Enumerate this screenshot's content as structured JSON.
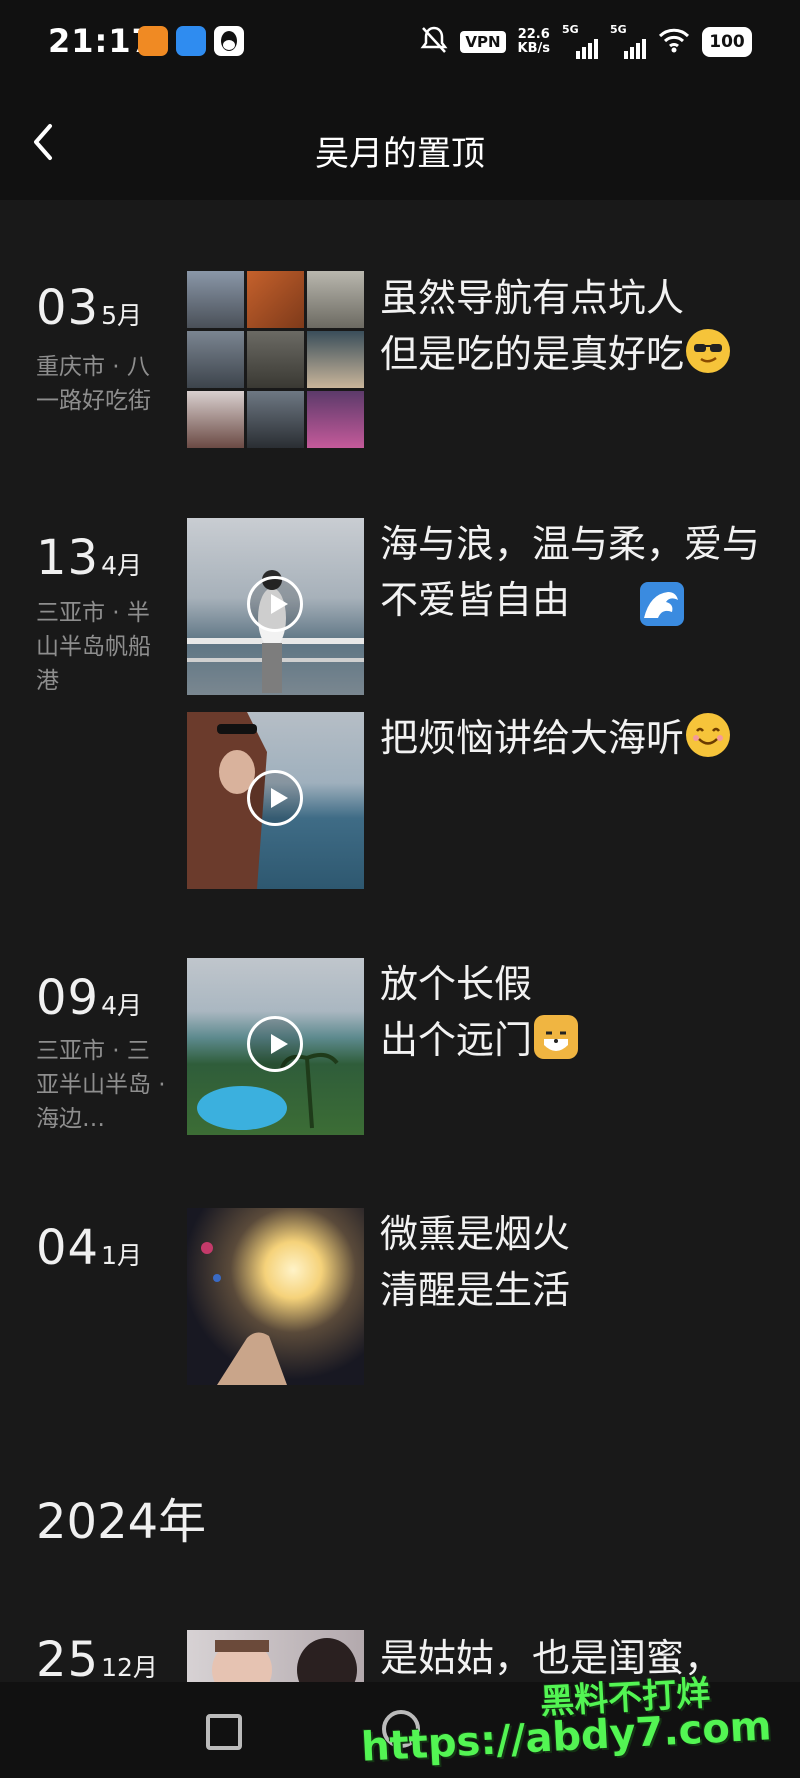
{
  "status_bar": {
    "time": "21:17",
    "vpn": "VPN",
    "net_speed_value": "22.6",
    "net_speed_unit": "KB/s",
    "signal1_label": "5G",
    "signal2_label": "5G",
    "battery": "100"
  },
  "header": {
    "title": "吴月的置顶"
  },
  "entries": [
    {
      "day": "03",
      "month": "5月",
      "location": "重庆市 · 八一路好吃街",
      "caption_line1": "虽然导航有点坑人",
      "caption_line2": "但是吃的是真好吃",
      "emoji": "sunglasses-emoji",
      "media": "photo-grid"
    },
    {
      "day": "13",
      "month": "4月",
      "location": "三亚市 · 半山半岛帆船港",
      "caption": "海与浪，温与柔，爱与不爱皆自由",
      "emoji": "wave-emoji",
      "media": "video"
    },
    {
      "caption": "把烦恼讲给大海听",
      "emoji": "smiling-emoji",
      "media": "video"
    },
    {
      "day": "09",
      "month": "4月",
      "location": "三亚市 · 三亚半山半岛 · 海边…",
      "caption_line1": "放个长假",
      "caption_line2": "出个远门",
      "emoji": "cat-emoji",
      "media": "video"
    },
    {
      "day": "04",
      "month": "1月",
      "caption_line1": "微熏是烟火",
      "caption_line2": "清醒是生活",
      "media": "photo"
    }
  ],
  "year_divider": "2024年",
  "last_entry": {
    "day": "25",
    "month": "12月",
    "caption": "是姑姑，也是闺蜜，"
  },
  "watermark": {
    "line1": "黑料不打烊",
    "line2": "https://abdy7.com"
  }
}
